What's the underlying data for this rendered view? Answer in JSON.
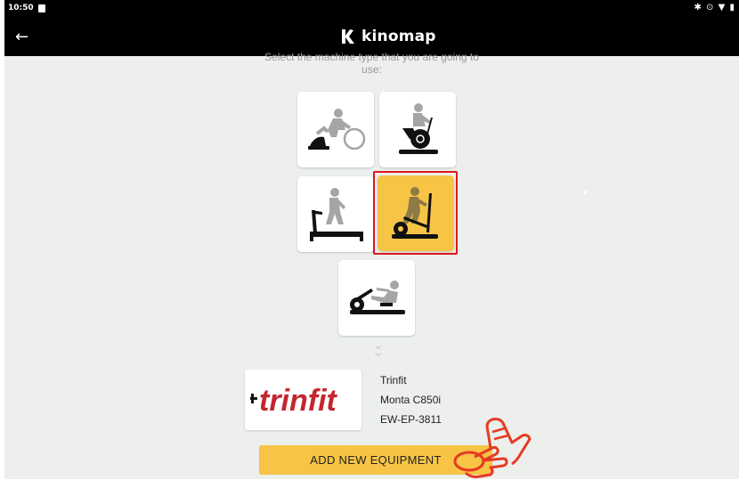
{
  "status_bar": {
    "time": "10:50",
    "icons": [
      "notification-icon",
      "bluetooth-icon",
      "data-icon",
      "wifi-icon",
      "battery-icon"
    ]
  },
  "app_bar": {
    "logo_text": "kinomap",
    "back_icon": "arrow-back-icon"
  },
  "main": {
    "prompt_line1": "Select the machine type that you are going to",
    "prompt_line2": "use:",
    "machines": [
      {
        "id": "bike-trainer",
        "icon": "bike-trainer-icon",
        "selected": false
      },
      {
        "id": "exercise-bike",
        "icon": "exercise-bike-icon",
        "selected": false
      },
      {
        "id": "treadmill",
        "icon": "treadmill-icon",
        "selected": false
      },
      {
        "id": "elliptical",
        "icon": "elliptical-icon",
        "selected": true
      },
      {
        "id": "rower",
        "icon": "rower-icon",
        "selected": false
      }
    ],
    "expand_icon": "chevron-double-down-icon",
    "equipment": {
      "logo_text": "trinfit",
      "brand": "Trinfit",
      "model": "Monta C850i",
      "code": "EW-EP-3811"
    },
    "add_button_label": "ADD NEW EQUIPMENT"
  },
  "colors": {
    "accent": "#f7c446",
    "selection_border": "#e0161c",
    "background": "#ecefec",
    "brand_red": "#c4262e"
  }
}
